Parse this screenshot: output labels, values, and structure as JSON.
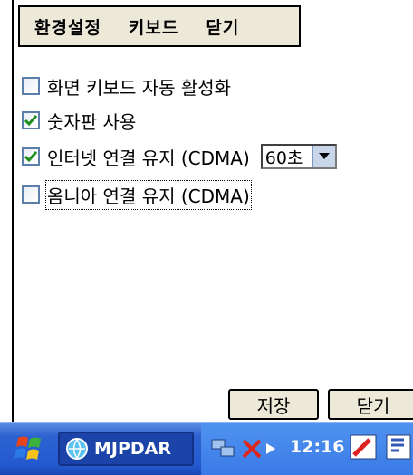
{
  "menu": {
    "settings_label": "환경설정",
    "keyboard_label": "키보드",
    "close_label": "닫기"
  },
  "options": [
    {
      "label": "화면 키보드 자동 활성화",
      "checked": false
    },
    {
      "label": "숫자판 사용",
      "checked": true
    },
    {
      "label": "인터넷 연결 유지 (CDMA)",
      "checked": true
    },
    {
      "label": "옴니아 연결 유지 (CDMA)",
      "checked": false
    }
  ],
  "keepalive_select": {
    "value": "60초"
  },
  "buttons": {
    "save_label": "저장",
    "close_label": "닫기"
  },
  "taskbar": {
    "app_label": "MJPDAR",
    "time": "12:16"
  },
  "colors": {
    "check": "#1d8e1d",
    "checkbox_border": "#5b7fa8",
    "taskbar": "#2d62d0"
  }
}
